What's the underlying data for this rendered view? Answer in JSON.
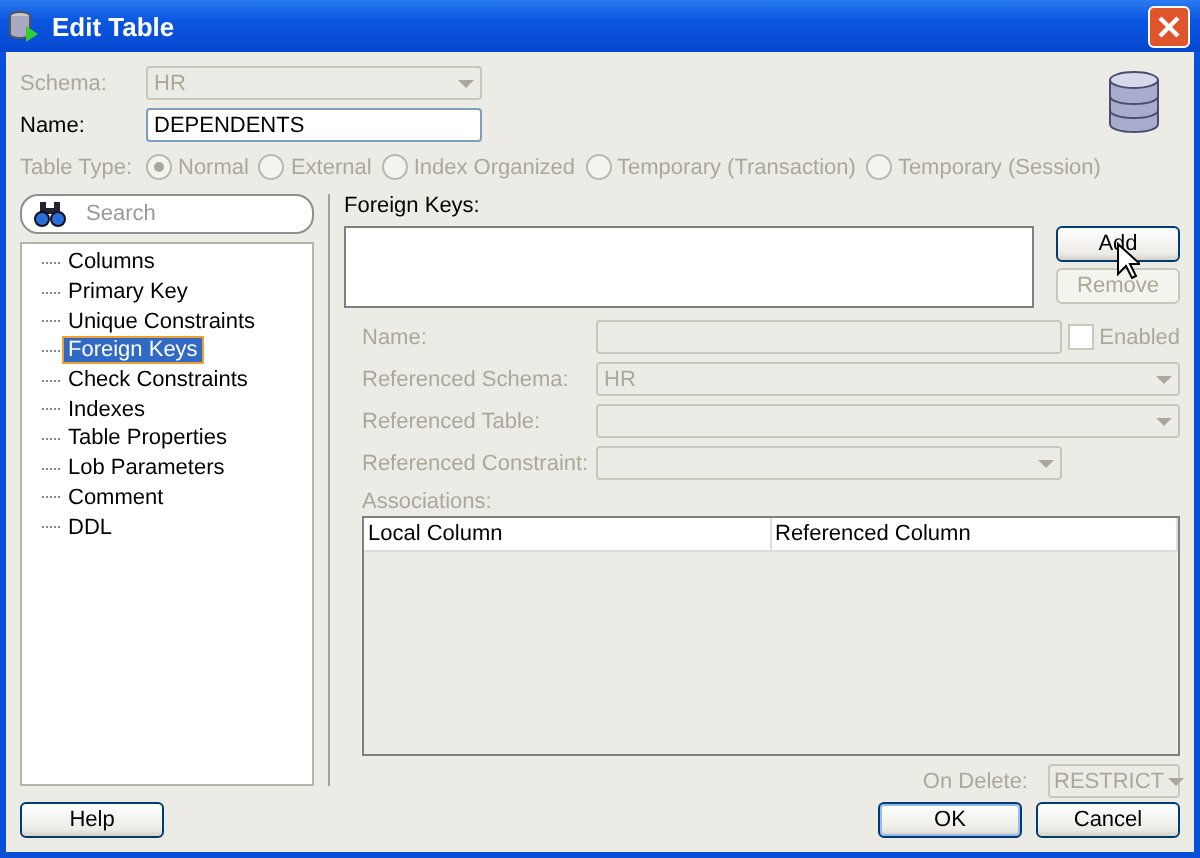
{
  "window": {
    "title": "Edit Table"
  },
  "schema": {
    "label": "Schema:",
    "value": "HR",
    "disabled": true
  },
  "name": {
    "label": "Name:",
    "value": "DEPENDENTS",
    "disabled": false
  },
  "table_type": {
    "label": "Table Type:",
    "disabled": true,
    "options": [
      {
        "label": "Normal",
        "selected": true
      },
      {
        "label": "External",
        "selected": false
      },
      {
        "label": "Index Organized",
        "selected": false
      },
      {
        "label": "Temporary (Transaction)",
        "selected": false
      },
      {
        "label": "Temporary (Session)",
        "selected": false
      }
    ]
  },
  "search": {
    "placeholder": "Search"
  },
  "tree": {
    "items": [
      {
        "label": "Columns",
        "selected": false
      },
      {
        "label": "Primary Key",
        "selected": false
      },
      {
        "label": "Unique Constraints",
        "selected": false
      },
      {
        "label": "Foreign Keys",
        "selected": true
      },
      {
        "label": "Check Constraints",
        "selected": false
      },
      {
        "label": "Indexes",
        "selected": false
      },
      {
        "label": "Table Properties",
        "selected": false
      },
      {
        "label": "Lob Parameters",
        "selected": false
      },
      {
        "label": "Comment",
        "selected": false
      },
      {
        "label": "DDL",
        "selected": false
      }
    ]
  },
  "foreign_keys": {
    "label": "Foreign Keys:",
    "buttons": [
      {
        "label": "Add",
        "disabled": false
      },
      {
        "label": "Remove",
        "disabled": true
      }
    ],
    "fields": [
      {
        "kind": "text",
        "label": "Name:",
        "disabled": true
      },
      {
        "kind": "select",
        "label": "Referenced Schema:",
        "value": "HR",
        "disabled": true
      },
      {
        "kind": "select",
        "label": "Referenced Table:",
        "disabled": true
      },
      {
        "kind": "short_select",
        "label": "Referenced Constraint:",
        "disabled": true
      }
    ],
    "enabled": {
      "label": "Enabled",
      "checked": false,
      "disabled": true
    },
    "associations": {
      "label": "Associations:",
      "columns": [
        "Local Column",
        "Referenced Column"
      ]
    },
    "on_delete": {
      "label": "On Delete:",
      "value": "RESTRICT",
      "disabled": true
    }
  },
  "buttons": {
    "help": "Help",
    "ok": "OK",
    "cancel": "Cancel"
  }
}
